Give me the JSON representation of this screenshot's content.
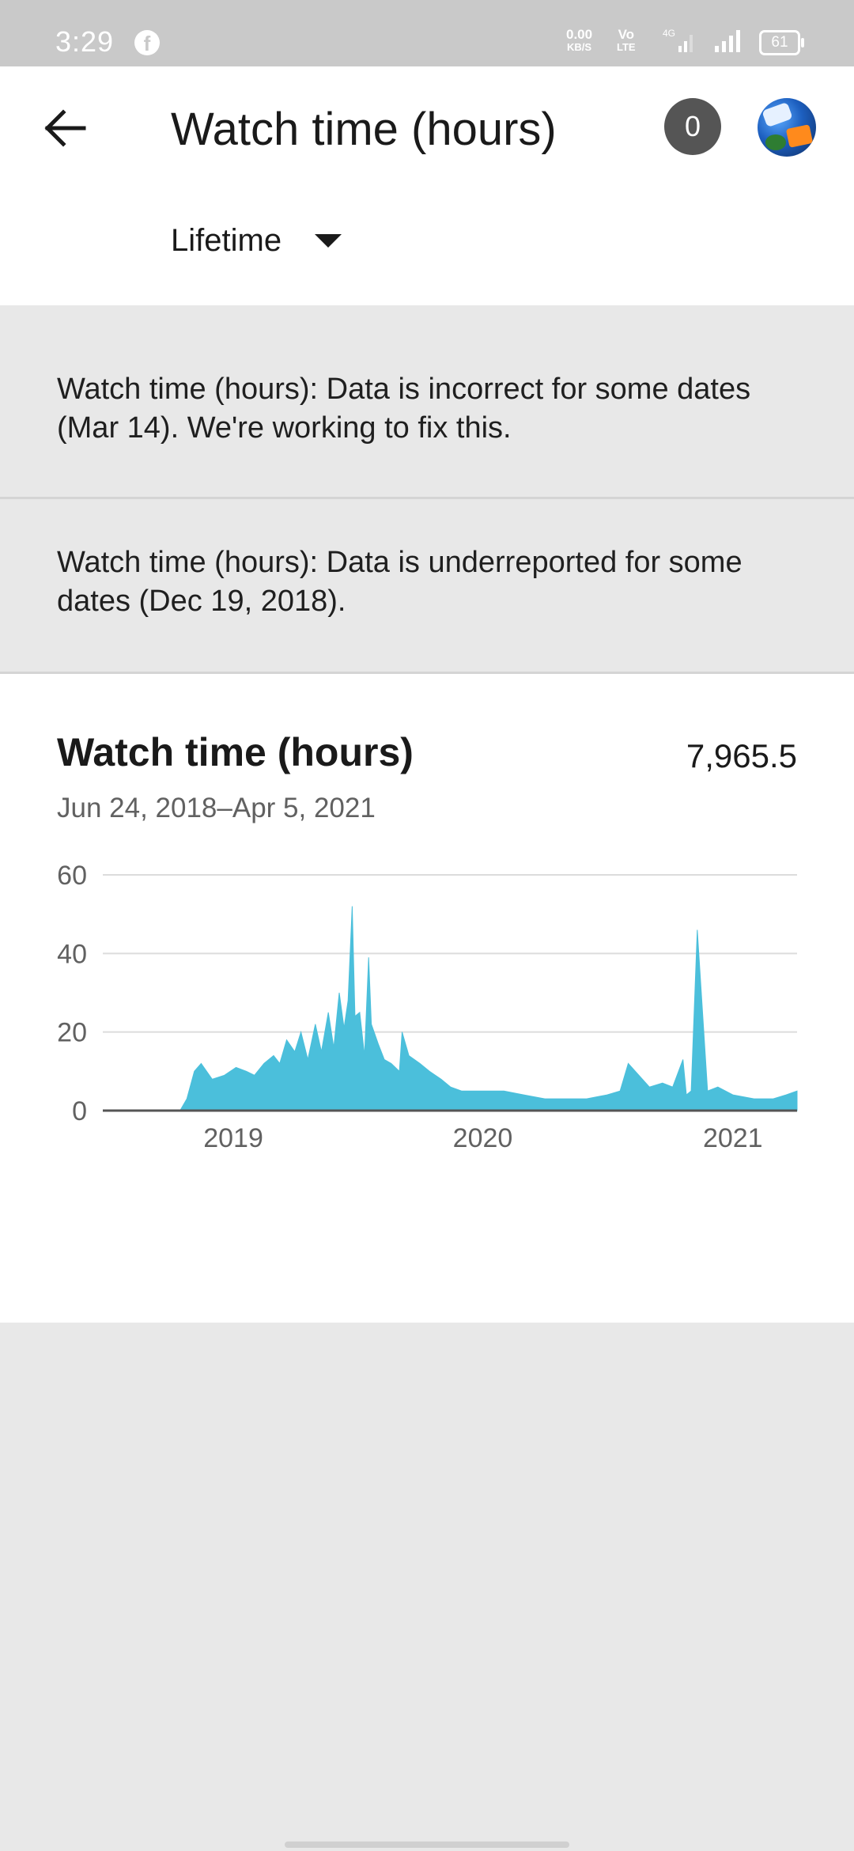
{
  "status_bar": {
    "time": "3:29",
    "net_speed": "0.00",
    "net_unit": "KB/S",
    "volte": "Vo",
    "volte_sub": "LTE",
    "network_type": "4G",
    "battery": "61",
    "icons": [
      "facebook-icon",
      "signal-4g-icon",
      "signal-icon",
      "battery-icon"
    ]
  },
  "app_bar": {
    "back_icon": "arrow-left-icon",
    "title": "Watch time (hours)",
    "notification_count": "0",
    "avatar": "channel-avatar"
  },
  "period_selector": {
    "label": "Lifetime",
    "icon": "caret-down-icon"
  },
  "notices": [
    {
      "text": "Watch time (hours): Data is incorrect for some dates (Mar 14). We're working to fix this."
    },
    {
      "text": "Watch time (hours): Data is underreported for some dates (Dec 19, 2018)."
    }
  ],
  "metric_card": {
    "title": "Watch time (hours)",
    "total": "7,965.5",
    "date_range": "Jun 24, 2018–Apr 5, 2021"
  },
  "colors": {
    "series": "#4bbfdb",
    "gridline": "#dcdcdc",
    "axis": "#555555",
    "status_bar": "#c9c9c9",
    "background": "#e8e8e8"
  },
  "chart_data": {
    "type": "area",
    "series": [
      {
        "x": [
          "2018-06-24",
          "2018-10-15",
          "2018-10-25",
          "2018-11-05",
          "2018-11-15",
          "2018-12-01",
          "2018-12-19",
          "2019-01-05",
          "2019-01-20",
          "2019-02-01",
          "2019-02-15",
          "2019-03-01",
          "2019-03-10",
          "2019-03-20",
          "2019-04-01",
          "2019-04-10",
          "2019-04-20",
          "2019-05-01",
          "2019-05-10",
          "2019-05-20",
          "2019-05-28",
          "2019-06-05",
          "2019-06-12",
          "2019-06-18",
          "2019-06-24",
          "2019-06-28",
          "2019-07-05",
          "2019-07-12",
          "2019-07-18",
          "2019-07-22",
          "2019-08-01",
          "2019-08-10",
          "2019-08-20",
          "2019-09-01",
          "2019-09-05",
          "2019-09-15",
          "2019-10-01",
          "2019-10-15",
          "2019-11-01",
          "2019-11-15",
          "2019-12-01",
          "2020-01-01",
          "2020-02-01",
          "2020-03-01",
          "2020-04-01",
          "2020-05-01",
          "2020-06-01",
          "2020-07-01",
          "2020-07-20",
          "2020-08-01",
          "2020-09-01",
          "2020-09-20",
          "2020-10-05",
          "2020-10-20",
          "2020-10-25",
          "2020-11-01",
          "2020-11-10",
          "2020-11-25",
          "2020-12-10",
          "2021-01-01",
          "2021-02-01",
          "2021-03-01",
          "2021-03-20",
          "2021-04-05"
        ],
        "values": [
          0,
          0,
          3,
          10,
          12,
          8,
          9,
          11,
          10,
          9,
          12,
          14,
          12,
          18,
          15,
          20,
          13,
          22,
          15,
          25,
          16,
          30,
          21,
          28,
          52,
          24,
          25,
          14,
          39,
          22,
          17,
          13,
          12,
          10,
          20,
          14,
          12,
          10,
          8,
          6,
          5,
          5,
          5,
          4,
          3,
          3,
          3,
          4,
          5,
          12,
          6,
          7,
          6,
          13,
          4,
          5,
          46,
          5,
          6,
          4,
          3,
          3,
          4,
          5
        ]
      }
    ],
    "title": "Watch time (hours)",
    "x_tick_labels": [
      "2019",
      "2020",
      "2021"
    ],
    "y_tick_labels": [
      "0",
      "20",
      "40",
      "60"
    ],
    "ylim": [
      0,
      60
    ],
    "xlim": [
      "2018-06-24",
      "2021-04-05"
    ],
    "grid": true,
    "legend": "none"
  },
  "navigation": {
    "home_indicator": "gesture-bar"
  }
}
